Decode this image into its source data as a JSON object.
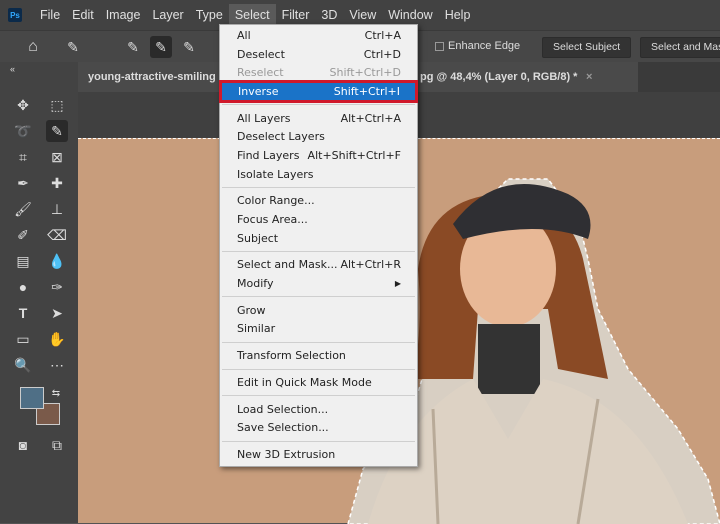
{
  "menubar": {
    "logo": "Ps",
    "items": [
      "File",
      "Edit",
      "Image",
      "Layer",
      "Type",
      "Select",
      "Filter",
      "3D",
      "View",
      "Window",
      "Help"
    ],
    "active": "Select"
  },
  "options": {
    "enhance_edge": "Enhance Edge",
    "select_subject": "Select Subject",
    "select_and_mask": "Select and Mask"
  },
  "tab": {
    "title_left": "young-attractive-smiling",
    "title_right": "pg @ 48,4% (Layer 0, RGB/8) *",
    "close": "×"
  },
  "colors": {
    "foreground": "#4f6f86",
    "background": "#7a5a4a",
    "accent": "#1a73c8",
    "highlight_border": "#d0192b",
    "canvas_bg": "#c89d7c"
  },
  "select_menu": {
    "groups": [
      [
        {
          "label": "All",
          "shortcut": "Ctrl+A"
        },
        {
          "label": "Deselect",
          "shortcut": "Ctrl+D"
        },
        {
          "label": "Reselect",
          "shortcut": "Shift+Ctrl+D",
          "disabled": true
        },
        {
          "label": "Inverse",
          "shortcut": "Shift+Ctrl+I",
          "highlighted": true
        }
      ],
      [
        {
          "label": "All Layers",
          "shortcut": "Alt+Ctrl+A"
        },
        {
          "label": "Deselect Layers",
          "shortcut": ""
        },
        {
          "label": "Find Layers",
          "shortcut": "Alt+Shift+Ctrl+F"
        },
        {
          "label": "Isolate Layers",
          "shortcut": ""
        }
      ],
      [
        {
          "label": "Color Range...",
          "shortcut": ""
        },
        {
          "label": "Focus Area...",
          "shortcut": ""
        },
        {
          "label": "Subject",
          "shortcut": ""
        }
      ],
      [
        {
          "label": "Select and Mask...",
          "shortcut": "Alt+Ctrl+R"
        },
        {
          "label": "Modify",
          "shortcut": "▶"
        }
      ],
      [
        {
          "label": "Grow",
          "shortcut": ""
        },
        {
          "label": "Similar",
          "shortcut": ""
        }
      ],
      [
        {
          "label": "Transform Selection",
          "shortcut": ""
        }
      ],
      [
        {
          "label": "Edit in Quick Mask Mode",
          "shortcut": ""
        }
      ],
      [
        {
          "label": "Load Selection...",
          "shortcut": ""
        },
        {
          "label": "Save Selection...",
          "shortcut": ""
        }
      ],
      [
        {
          "label": "New 3D Extrusion",
          "shortcut": ""
        }
      ]
    ]
  }
}
